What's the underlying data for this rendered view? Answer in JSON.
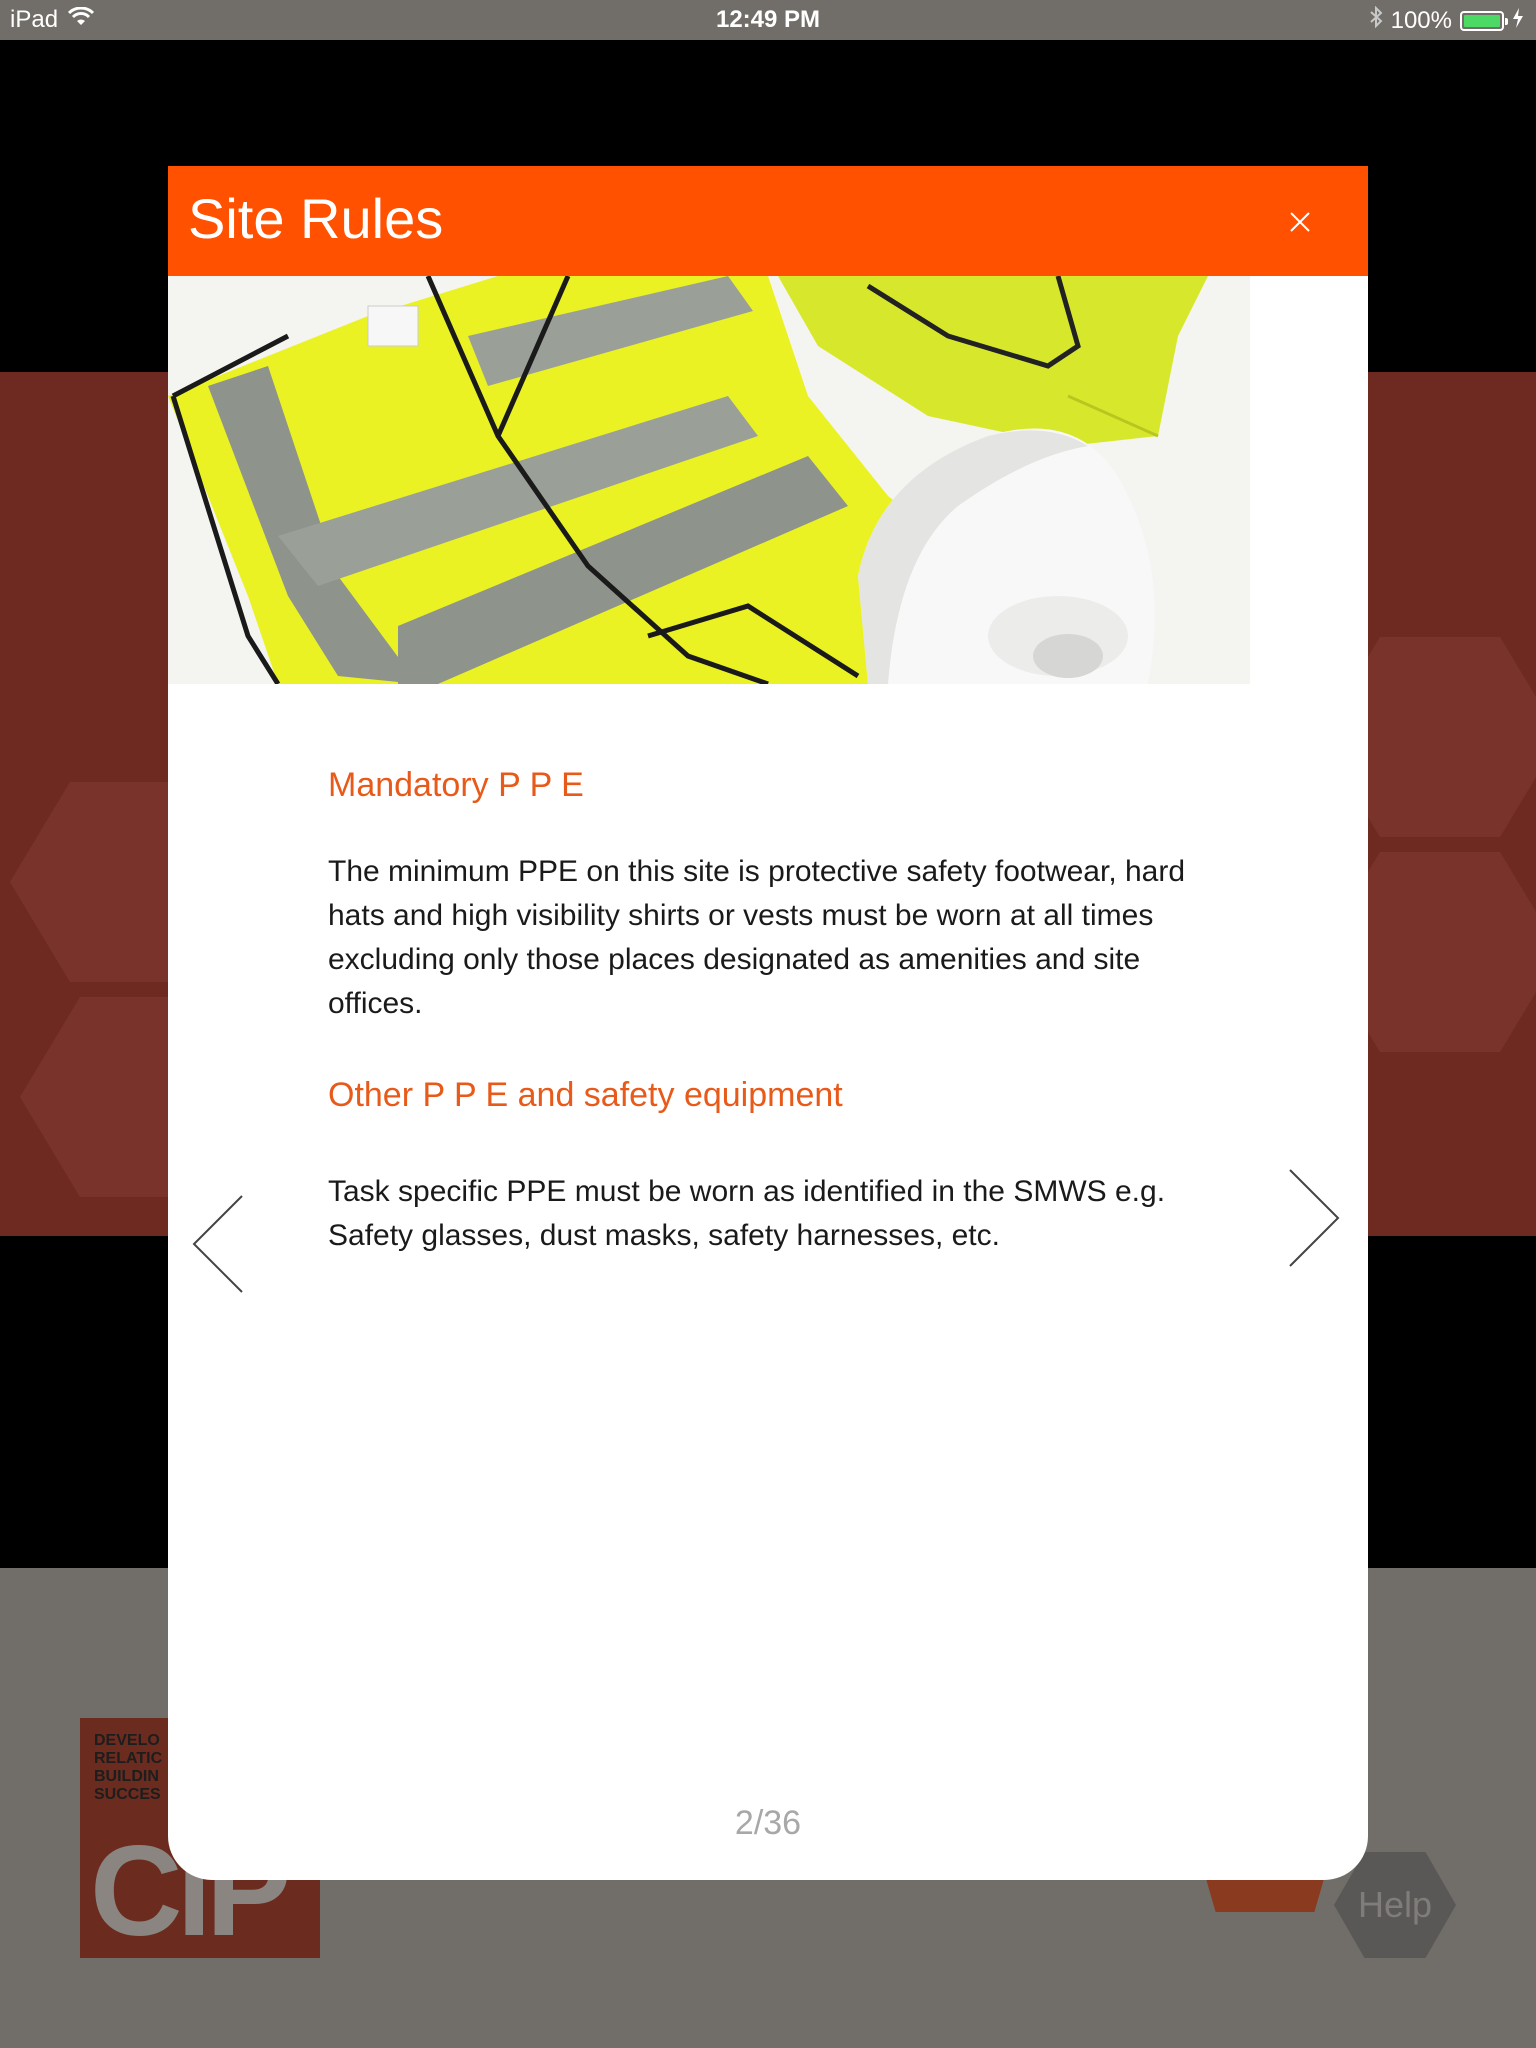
{
  "status_bar": {
    "device": "iPad",
    "time": "12:49 PM",
    "battery_percent": "100%",
    "battery_level": 1.0,
    "icons": [
      "wifi-icon",
      "bluetooth-icon",
      "battery-icon",
      "charging-icon"
    ]
  },
  "background": {
    "logo_tagline": "DEVELO\nRELATIC\nBUILDIN\nSUCCES",
    "logo_text": "CiP",
    "help_label": "Help"
  },
  "modal": {
    "title": "Site Rules",
    "close_icon": "close-icon",
    "sections": [
      {
        "heading": "Mandatory P P E",
        "body": "The minimum PPE on this site is protective safety footwear, hard hats and high visibility shirts or vests must be worn at all times excluding only those places designated as amenities and site offices."
      },
      {
        "heading": "Other P P E and safety equipment",
        "body": "Task specific PPE must be worn as identified in the SMWS e.g. Safety glasses, dust masks, safety harnesses, etc."
      }
    ],
    "page_indicator": "2/36",
    "prev_icon": "chevron-left-icon",
    "next_icon": "chevron-right-icon"
  },
  "colors": {
    "header_orange": "#ff5100",
    "heading_orange": "#e85a1a",
    "status_bar_grey": "#716e69",
    "background_red": "#6e2a20"
  }
}
